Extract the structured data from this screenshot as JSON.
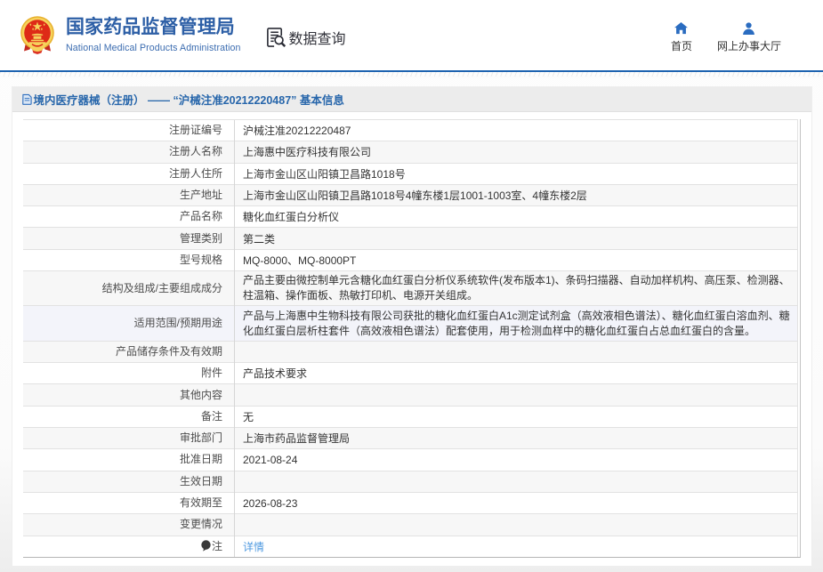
{
  "header": {
    "brand": {
      "title_cn": "国家药品监督管理局",
      "title_en": "National Medical Products Administration"
    },
    "section_label": "数据查询",
    "nav": [
      {
        "label": "首页",
        "icon": "home-icon"
      },
      {
        "label": "网上办事大厅",
        "icon": "user-icon"
      }
    ]
  },
  "content": {
    "card_title": "境内医疗器械（注册） —— “沪械注准20212220487” 基本信息",
    "table": {
      "rows": [
        {
          "label": "注册证编号",
          "value": "沪械注准20212220487"
        },
        {
          "label": "注册人名称",
          "value": "上海惠中医疗科技有限公司"
        },
        {
          "label": "注册人住所",
          "value": "上海市金山区山阳镇卫昌路1018号"
        },
        {
          "label": "生产地址",
          "value": "上海市金山区山阳镇卫昌路1018号4幢东楼1层1001-1003室、4幢东楼2层"
        },
        {
          "label": "产品名称",
          "value": "糖化血红蛋白分析仪"
        },
        {
          "label": "管理类别",
          "value": "第二类"
        },
        {
          "label": "型号规格",
          "value": "MQ-8000、MQ-8000PT"
        },
        {
          "label": "结构及组成/主要组成成分",
          "value": "产品主要由微控制单元含糖化血红蛋白分析仪系统软件(发布版本1)、条码扫描器、自动加样机构、高压泵、检测器、柱温箱、操作面板、热敏打印机、电源开关组成。"
        },
        {
          "label": "适用范围/预期用途",
          "value": "产品与上海惠中生物科技有限公司获批的糖化血红蛋白A1c测定试剂盒（高效液相色谱法）、糖化血红蛋白溶血剂、糖化血红蛋白层析柱套件（高效液相色谱法）配套使用，用于检测血样中的糖化血红蛋白占总血红蛋白的含量。"
        },
        {
          "label": "产品储存条件及有效期",
          "value": ""
        },
        {
          "label": "附件",
          "value": "产品技术要求"
        },
        {
          "label": "其他内容",
          "value": ""
        },
        {
          "label": "备注",
          "value": "无"
        },
        {
          "label": "审批部门",
          "value": "上海市药品监督管理局"
        },
        {
          "label": "批准日期",
          "value": "2021-08-24"
        },
        {
          "label": "生效日期",
          "value": ""
        },
        {
          "label": "有效期至",
          "value": "2026-08-23"
        },
        {
          "label": "变更情况",
          "value": ""
        },
        {
          "label": "注",
          "value": "详情"
        }
      ]
    }
  },
  "colors": {
    "brand_blue": "#2d5fa6",
    "header_line_blue": "#1e63b0",
    "card_title_blue": "#2766ab",
    "link_blue": "#4f9ae0",
    "row_alt_gray": "#f7f7f7",
    "row_highlight": "#f3f4fa",
    "titlebar_gray": "#ececec",
    "emblem_red": "#de2910",
    "emblem_gold": "#f0c340"
  }
}
